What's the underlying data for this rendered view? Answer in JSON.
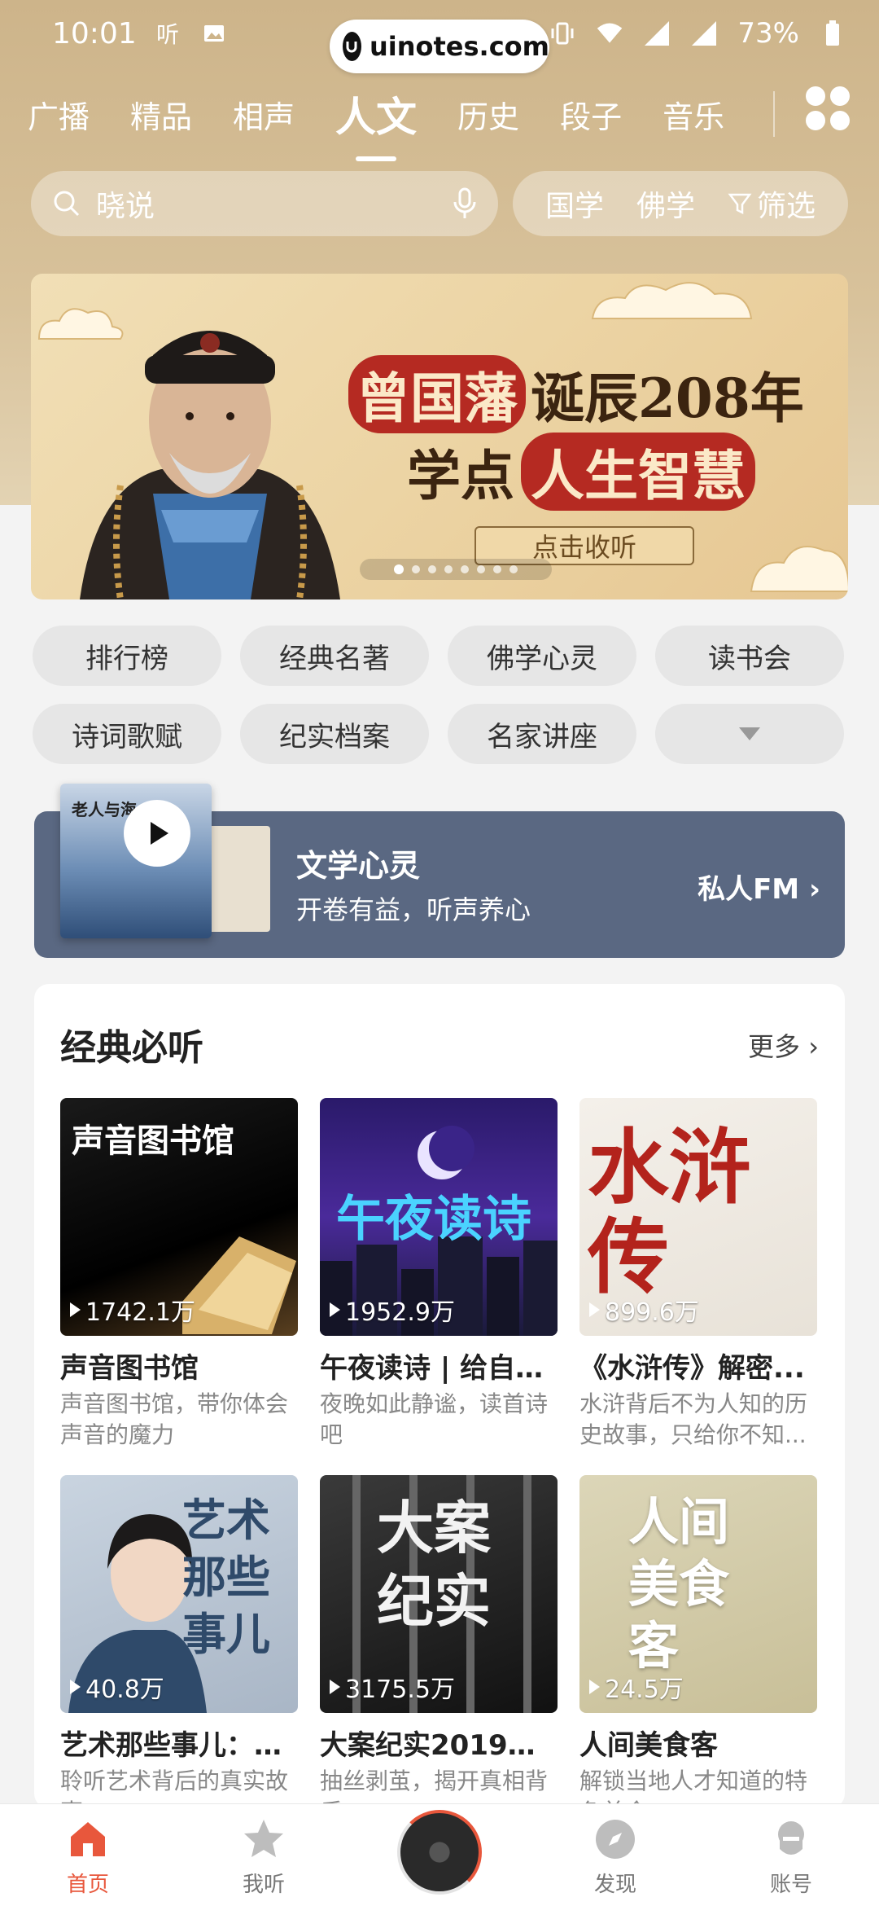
{
  "status_bar": {
    "time": "10:01",
    "battery": "73%",
    "url": "uinotes.com"
  },
  "top_tabs": [
    "广播",
    "精品",
    "相声",
    "人文",
    "历史",
    "段子",
    "音乐"
  ],
  "active_tab": 3,
  "search": {
    "placeholder": "晓说"
  },
  "quick_filters": [
    "国学",
    "佛学"
  ],
  "filter_label": "筛选",
  "banner": {
    "name_highlight": "曾国藩",
    "title_rest": "诞辰208年",
    "line2_prefix": "学点",
    "line2_highlight": "人生智慧",
    "cta": "点击收听",
    "dot_count": 8,
    "active_dot": 0
  },
  "categories": [
    "排行榜",
    "经典名著",
    "佛学心灵",
    "读书会",
    "诗词歌赋",
    "纪实档案",
    "名家讲座"
  ],
  "fm": {
    "cover_title": "老人与海",
    "title": "文学心灵",
    "subtitle": "开卷有益，听声养心",
    "link": "私人FM"
  },
  "section": {
    "title": "经典必听",
    "more": "更多",
    "albums": [
      {
        "title": "声音图书馆",
        "desc": "声音图书馆，带你体会声音的魔力",
        "plays": "1742.1万",
        "cover_text": "声音图书馆"
      },
      {
        "title": "午夜读诗 | 给自己...",
        "desc": "夜晚如此静谧，读首诗吧",
        "plays": "1952.9万",
        "cover_text": "午夜读诗"
      },
      {
        "title": "《水浒传》解密...",
        "desc": "水浒背后不为人知的历史故事，只给你不知...",
        "plays": "899.6万",
        "cover_text": "水浒传"
      },
      {
        "title": "艺术那些事儿：1...",
        "desc": "聆听艺术背后的真实故事",
        "plays": "40.8万",
        "cover_text": "艺术那些事儿"
      },
      {
        "title": "大案纪实2019—...",
        "desc": "抽丝剥茧，揭开真相背后",
        "plays": "3175.5万",
        "cover_text": "大案纪实"
      },
      {
        "title": "人间美食客",
        "desc": "解锁当地人才知道的特色美食",
        "plays": "24.5万",
        "cover_text": "人间美食客"
      }
    ]
  },
  "bottom_nav": [
    "首页",
    "我听",
    "",
    "发现",
    "账号"
  ],
  "colors": {
    "accent": "#e8573c",
    "header": "#cdb48a",
    "fm_card": "#5a6882"
  }
}
